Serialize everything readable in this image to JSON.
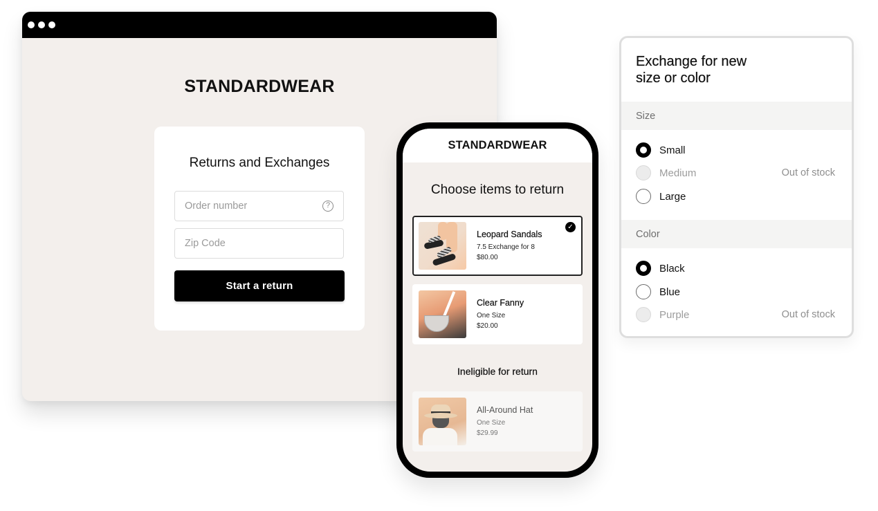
{
  "desktop": {
    "window_controls": [
      "dot",
      "dot",
      "dot"
    ],
    "brand": "STANDARDWEAR",
    "form": {
      "title": "Returns and Exchanges",
      "order_number_placeholder": "Order number",
      "order_help_icon": "?",
      "zip_code_placeholder": "Zip Code",
      "submit_label": "Start a return"
    }
  },
  "mobile": {
    "brand": "STANDARDWEAR",
    "title": "Choose items to return",
    "items": [
      {
        "name": "Leopard Sandals",
        "detail": "7.5  Exchange for 8",
        "price": "$80.00",
        "selected": true,
        "check_icon": "✓"
      },
      {
        "name": "Clear Fanny",
        "detail": "One Size",
        "price": "$20.00",
        "selected": false
      }
    ],
    "ineligible_title": "Ineligible for return",
    "ineligible_items": [
      {
        "name": "All-Around Hat",
        "detail": "One Size",
        "price": "$29.99"
      }
    ]
  },
  "exchange": {
    "title": "Exchange for new size or color",
    "size": {
      "label": "Size",
      "options": [
        {
          "label": "Small",
          "checked": true,
          "disabled": false,
          "status": ""
        },
        {
          "label": "Medium",
          "checked": false,
          "disabled": true,
          "status": "Out of stock"
        },
        {
          "label": "Large",
          "checked": false,
          "disabled": false,
          "status": ""
        }
      ]
    },
    "color": {
      "label": "Color",
      "options": [
        {
          "label": "Black",
          "checked": true,
          "disabled": false,
          "status": ""
        },
        {
          "label": "Blue",
          "checked": false,
          "disabled": false,
          "status": ""
        },
        {
          "label": "Purple",
          "checked": false,
          "disabled": true,
          "status": "Out of stock"
        }
      ]
    }
  },
  "colors": {
    "page_bg": "#f3efec",
    "primary": "#000000",
    "muted_text": "#9c9c9c",
    "section_bg": "#f4f4f3"
  }
}
